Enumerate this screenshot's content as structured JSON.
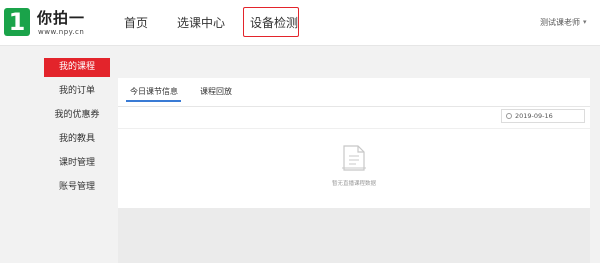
{
  "header": {
    "logo": {
      "mark": "1",
      "name": "你拍一",
      "url": "www.npy.cn"
    },
    "nav": [
      {
        "label": "首页"
      },
      {
        "label": "选课中心"
      },
      {
        "label": "设备检测"
      }
    ],
    "user": {
      "name": "测试课老师",
      "caret": "▾"
    }
  },
  "sidebar": {
    "items": [
      {
        "label": "我的课程",
        "active": true
      },
      {
        "label": "我的订单",
        "active": false
      },
      {
        "label": "我的优惠券",
        "active": false
      },
      {
        "label": "我的教具",
        "active": false
      },
      {
        "label": "课时管理",
        "active": false
      },
      {
        "label": "账号管理",
        "active": false
      }
    ]
  },
  "main": {
    "tabs": [
      {
        "label": "今日课节信息",
        "active": true
      },
      {
        "label": "课程回放",
        "active": false
      }
    ],
    "date_filter": {
      "value": "2019-09-16"
    },
    "empty_state": {
      "text": "暂无直播课程数据"
    }
  },
  "colors": {
    "accent_red": "#e3242b",
    "brand_green": "#1aa34a",
    "tab_blue": "#3a7bd5"
  }
}
